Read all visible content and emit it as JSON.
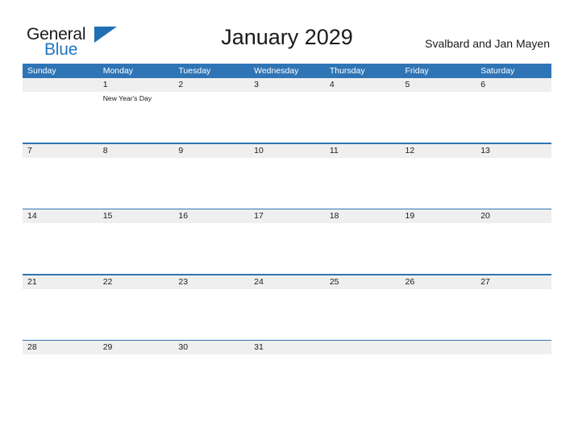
{
  "brand": {
    "name_dark": "General",
    "name_blue": "Blue",
    "triangle_color": "#1f6fb4"
  },
  "header": {
    "title": "January 2029",
    "locale": "Svalbard and Jan Mayen"
  },
  "theme": {
    "header_blue": "#2f75b5",
    "date_band_gray": "#efefef",
    "separator_blue": "#2f75b5",
    "text_dark": "#1a1a1a",
    "background": "#ffffff"
  },
  "calendar": {
    "month": "January",
    "year": "2029",
    "weekday_headers": [
      "Sunday",
      "Monday",
      "Tuesday",
      "Wednesday",
      "Thursday",
      "Friday",
      "Saturday"
    ],
    "weeks": [
      {
        "days": [
          {
            "num": "",
            "event": ""
          },
          {
            "num": "1",
            "event": "New Year's Day"
          },
          {
            "num": "2",
            "event": ""
          },
          {
            "num": "3",
            "event": ""
          },
          {
            "num": "4",
            "event": ""
          },
          {
            "num": "5",
            "event": ""
          },
          {
            "num": "6",
            "event": ""
          }
        ]
      },
      {
        "days": [
          {
            "num": "7",
            "event": ""
          },
          {
            "num": "8",
            "event": ""
          },
          {
            "num": "9",
            "event": ""
          },
          {
            "num": "10",
            "event": ""
          },
          {
            "num": "11",
            "event": ""
          },
          {
            "num": "12",
            "event": ""
          },
          {
            "num": "13",
            "event": ""
          }
        ]
      },
      {
        "days": [
          {
            "num": "14",
            "event": ""
          },
          {
            "num": "15",
            "event": ""
          },
          {
            "num": "16",
            "event": ""
          },
          {
            "num": "17",
            "event": ""
          },
          {
            "num": "18",
            "event": ""
          },
          {
            "num": "19",
            "event": ""
          },
          {
            "num": "20",
            "event": ""
          }
        ]
      },
      {
        "days": [
          {
            "num": "21",
            "event": ""
          },
          {
            "num": "22",
            "event": ""
          },
          {
            "num": "23",
            "event": ""
          },
          {
            "num": "24",
            "event": ""
          },
          {
            "num": "25",
            "event": ""
          },
          {
            "num": "26",
            "event": ""
          },
          {
            "num": "27",
            "event": ""
          }
        ]
      },
      {
        "days": [
          {
            "num": "28",
            "event": ""
          },
          {
            "num": "29",
            "event": ""
          },
          {
            "num": "30",
            "event": ""
          },
          {
            "num": "31",
            "event": ""
          },
          {
            "num": "",
            "event": ""
          },
          {
            "num": "",
            "event": ""
          },
          {
            "num": "",
            "event": ""
          }
        ]
      }
    ]
  }
}
